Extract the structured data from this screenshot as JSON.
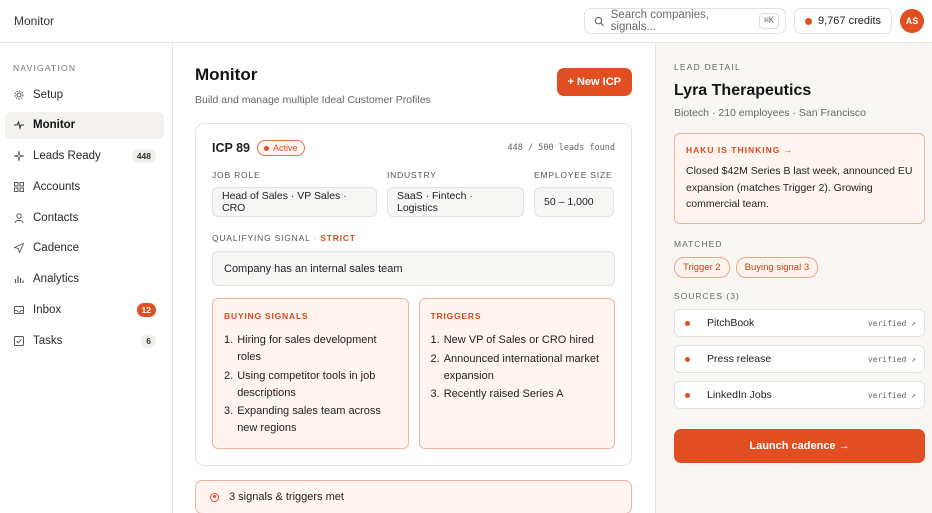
{
  "topbar": {
    "title": "Monitor",
    "search_placeholder": "Search companies, signals...",
    "search_kbd": "⌘K",
    "credits": "9,767 credits",
    "avatar": "AS"
  },
  "sidebar": {
    "heading": "NAVIGATION",
    "items": [
      {
        "label": "Setup",
        "icon": "gear-icon",
        "badge": ""
      },
      {
        "label": "Monitor",
        "icon": "pulse-icon",
        "badge": ""
      },
      {
        "label": "Leads Ready",
        "icon": "sparkle-icon",
        "badge": "448"
      },
      {
        "label": "Accounts",
        "icon": "grid-icon",
        "badge": ""
      },
      {
        "label": "Contacts",
        "icon": "user-icon",
        "badge": ""
      },
      {
        "label": "Cadence",
        "icon": "send-icon",
        "badge": ""
      },
      {
        "label": "Analytics",
        "icon": "bar-chart-icon",
        "badge": ""
      },
      {
        "label": "Inbox",
        "icon": "inbox-icon",
        "badge": "12"
      },
      {
        "label": "Tasks",
        "icon": "checkbox-icon",
        "badge": "6"
      }
    ]
  },
  "main": {
    "title": "Monitor",
    "subtitle": "Build and manage multiple Ideal Customer Profiles",
    "new_button": "+ New ICP",
    "card": {
      "name": "ICP 89",
      "status": "Active",
      "leads_found": "448 / 500 leads found",
      "fields": [
        {
          "label": "JOB ROLE",
          "value": "Head of Sales · VP Sales · CRO"
        },
        {
          "label": "INDUSTRY",
          "value": "SaaS · Fintech · Logistics"
        },
        {
          "label": "EMPLOYEE SIZE",
          "value": "50 – 1,000"
        }
      ],
      "qualifying_label": "QUALIFYING SIGNAL · ",
      "qualifying_mode": "STRICT",
      "qualifying_value": "Company has an internal sales team",
      "buying_signals": {
        "title": "BUYING SIGNALS",
        "items": [
          "Hiring for sales development roles",
          "Using competitor tools in job descriptions",
          "Expanding sales team across new regions"
        ]
      },
      "triggers": {
        "title": "TRIGGERS",
        "items": [
          "New VP of Sales or CRO hired",
          "Announced international market expansion",
          "Recently raised Series A"
        ]
      }
    },
    "met_banner": "3 signals & triggers met"
  },
  "detail": {
    "heading": "LEAD DETAIL",
    "company": "Lyra Therapeutics",
    "meta": "Biotech · 210 employees · San Francisco",
    "thinking_title": "HAKU IS THINKING →",
    "thinking_text": "Closed $42M Series B last week, announced EU expansion (matches Trigger 2). Growing commercial team.",
    "matched_label": "MATCHED",
    "matched_tags": [
      "Trigger 2",
      "Buying signal 3"
    ],
    "sources_label": "SOURCES (3)",
    "sources": [
      {
        "name": "PitchBook",
        "status": "verified ↗"
      },
      {
        "name": "Press release",
        "status": "verified ↗"
      },
      {
        "name": "LinkedIn Jobs",
        "status": "verified ↗"
      }
    ],
    "launch_button": "Launch cadence →"
  },
  "colors": {
    "accent": "#e04e22",
    "accent_soft": "#fff4ef"
  }
}
